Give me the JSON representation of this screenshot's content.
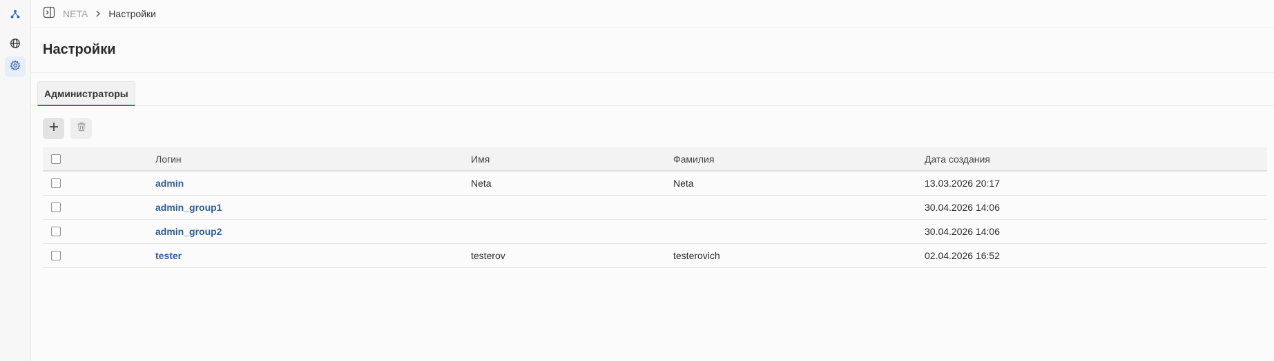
{
  "breadcrumb": {
    "root": "NETA",
    "current": "Настройки"
  },
  "page": {
    "title": "Настройки"
  },
  "tabs": [
    {
      "label": "Администраторы",
      "active": true
    }
  ],
  "icons": {
    "logo": "network-logo-icon",
    "globe": "globe-icon",
    "settings": "gear-icon",
    "collapse": "sidebar-toggle-icon",
    "separator": "chevron-right-icon",
    "add": "plus-icon",
    "delete": "trash-icon"
  },
  "colors": {
    "accent": "#2e5d97",
    "link": "#2e5d97",
    "active_nav_bg": "#e7eef7"
  },
  "table": {
    "columns": [
      "Логин",
      "Имя",
      "Фамилия",
      "Дата создания"
    ],
    "rows": [
      {
        "login": "admin",
        "name": "Neta",
        "surname": "Neta",
        "created": "13.03.2026 20:17"
      },
      {
        "login": "admin_group1",
        "name": "",
        "surname": "",
        "created": "30.04.2026 14:06"
      },
      {
        "login": "admin_group2",
        "name": "",
        "surname": "",
        "created": "30.04.2026 14:06"
      },
      {
        "login": "tester",
        "name": "testerov",
        "surname": "testerovich",
        "created": "02.04.2026 16:52"
      }
    ]
  }
}
